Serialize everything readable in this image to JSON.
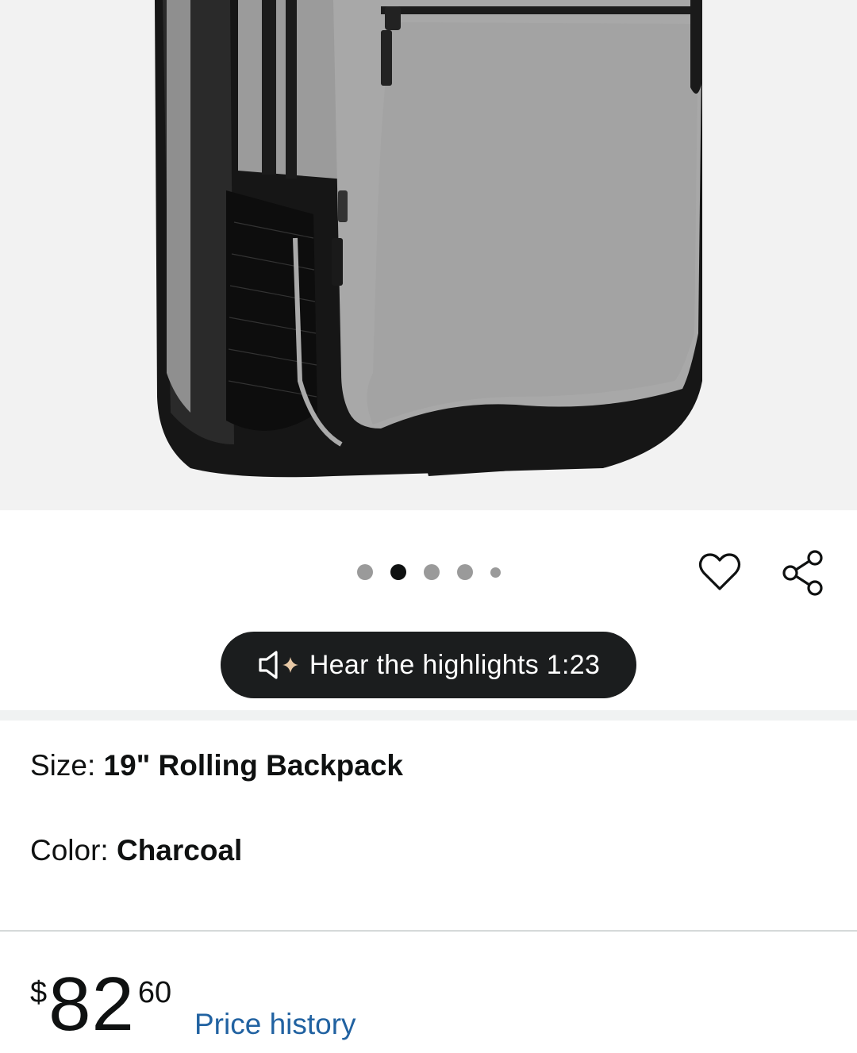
{
  "product_image": {
    "alt": "Charcoal rolling backpack"
  },
  "carousel": {
    "dot_count": 5,
    "active_index": 1
  },
  "actions": {
    "wishlist_icon": "heart-outline-icon",
    "share_icon": "share-icon"
  },
  "highlights": {
    "label": "Hear the highlights 1:23",
    "icon": "speaker-sparkle-icon"
  },
  "variations": {
    "size_label": "Size: ",
    "size_value": "19\" Rolling Backpack",
    "color_label": "Color: ",
    "color_value": "Charcoal"
  },
  "price": {
    "currency": "$",
    "whole": "82",
    "fraction": "60",
    "history_link": "Price history"
  },
  "colors": {
    "pill_bg": "#1b1d1e",
    "link": "#2162a1",
    "image_bg": "#f2f2f2",
    "sparkle": "#e8c9a6"
  }
}
